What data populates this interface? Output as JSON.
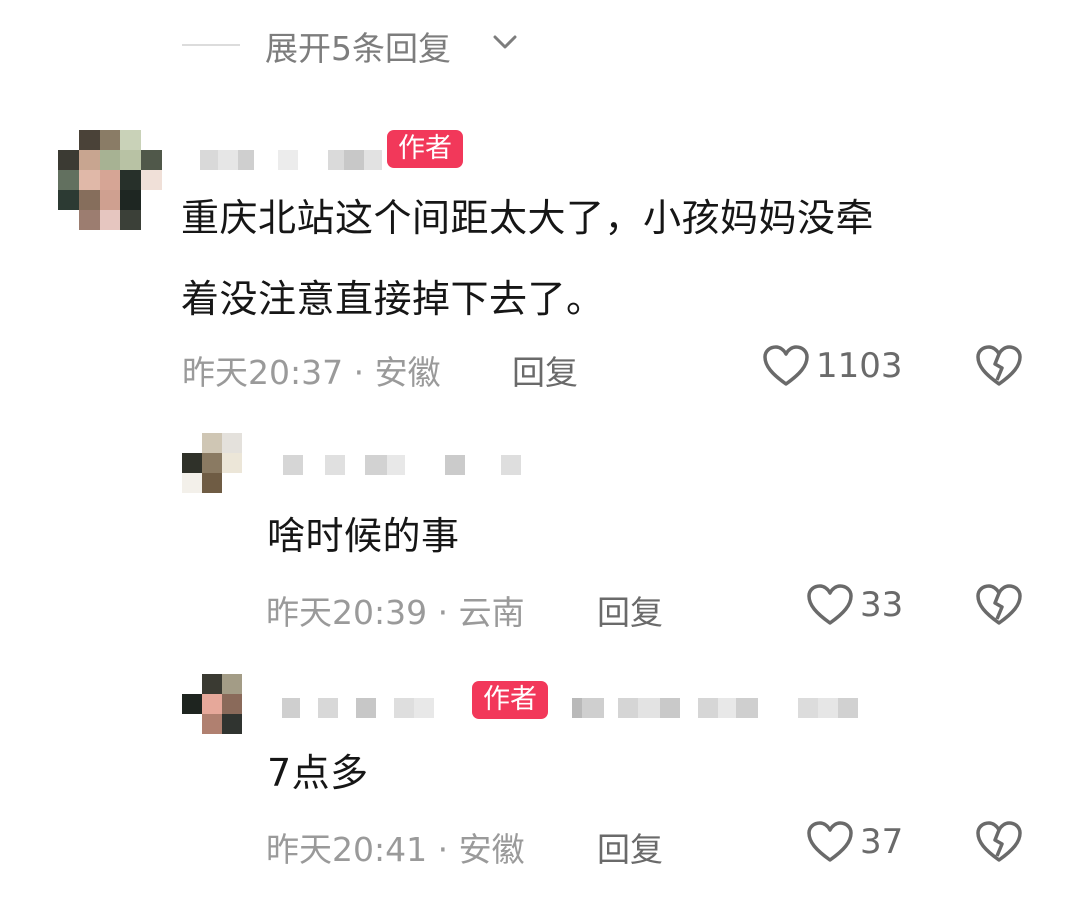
{
  "thread": {
    "expand_label": "展开5条回复"
  },
  "comments": [
    {
      "author_badge": "作者",
      "text_line1": "重庆北站",
      "text_line1b": "这个间距太大了，小孩妈妈没牵",
      "text_line2": "着没注意直接掉下去了。",
      "meta": "昨天20:37 · 安徽",
      "reply_label": "回复",
      "likes": "1103"
    },
    {
      "text": "啥时候的事",
      "meta": "昨天20:39 · 云南",
      "reply_label": "回复",
      "likes": "33"
    },
    {
      "author_badge": "作者",
      "text": "7点多",
      "meta": "昨天20:41 · 安徽",
      "reply_label": "回复",
      "likes": "37"
    }
  ],
  "colors": {
    "badge": "#f2385a",
    "meta": "#9a9a9a",
    "text": "#161616"
  },
  "icons": [
    "chevron-down-icon",
    "heart-icon",
    "broken-heart-icon"
  ]
}
